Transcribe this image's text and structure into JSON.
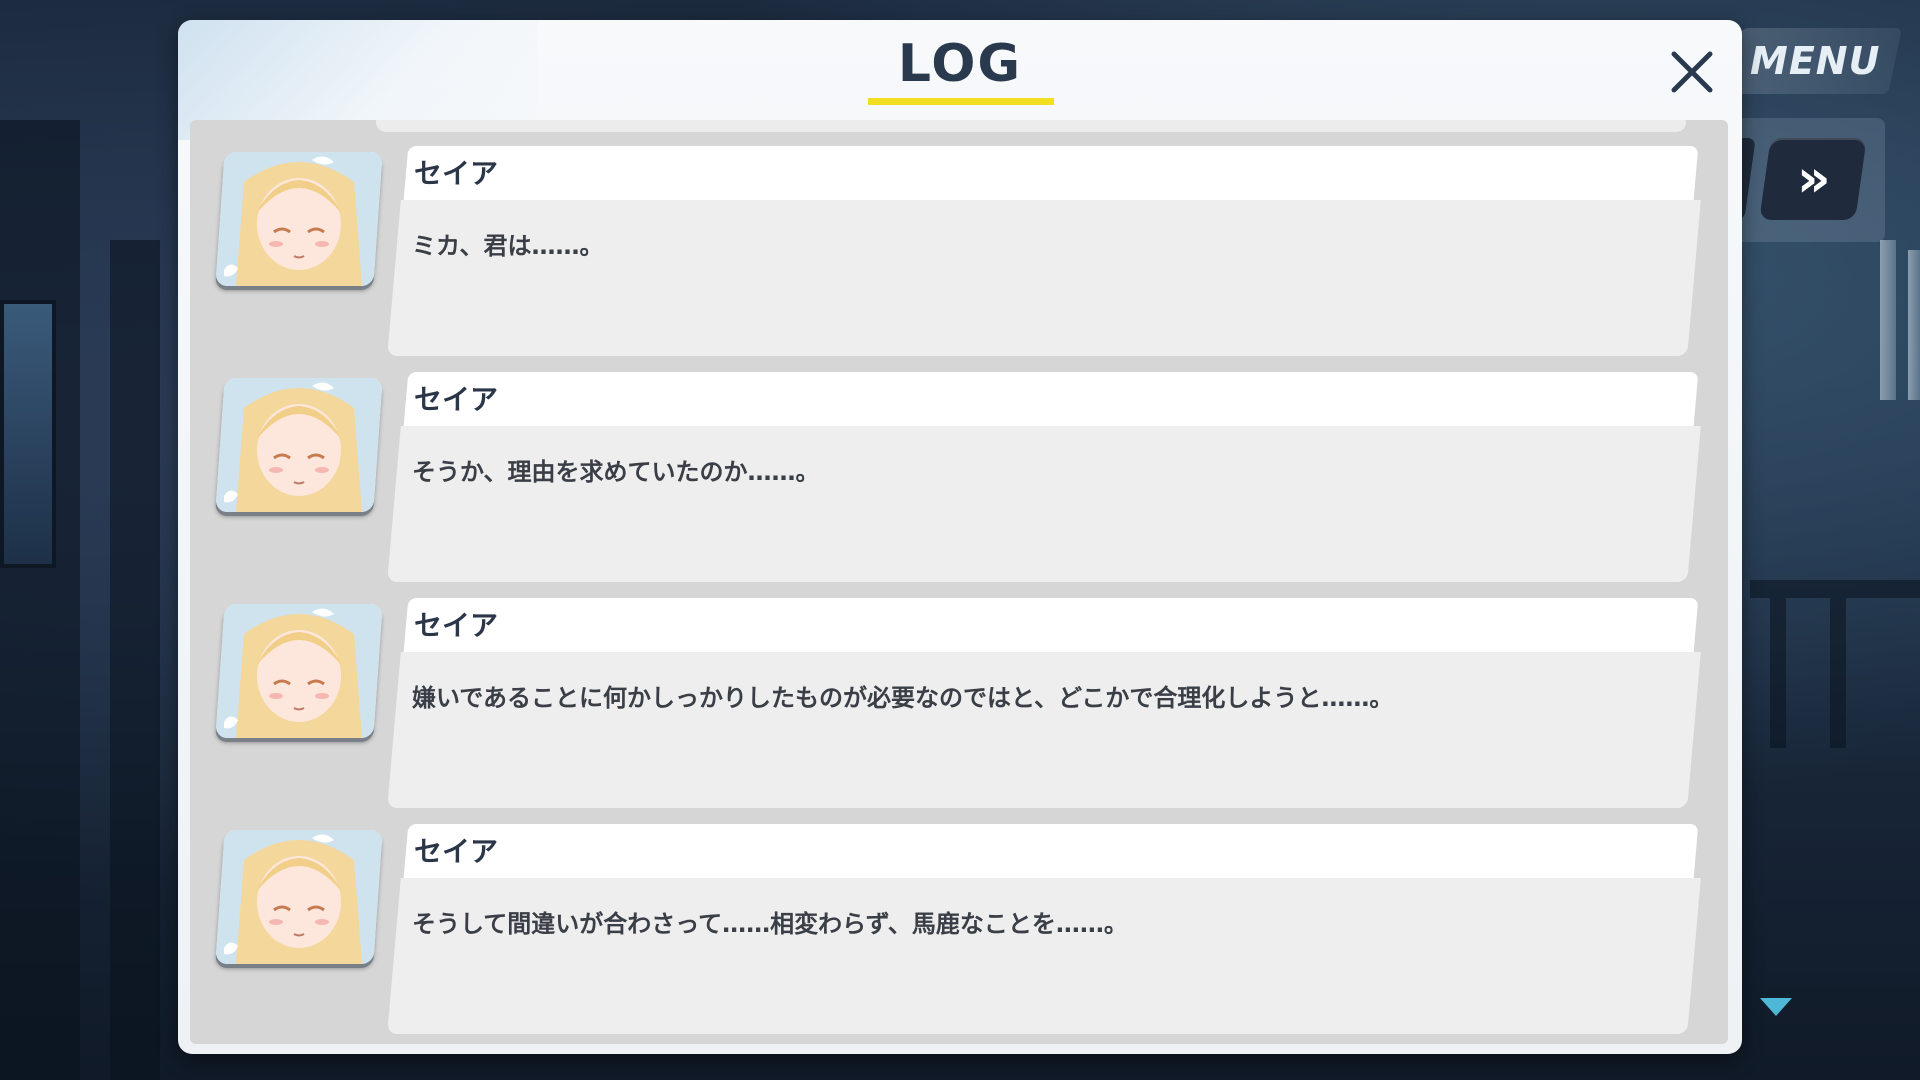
{
  "header": {
    "title": "LOG",
    "close_icon": "close-icon"
  },
  "side_controls": {
    "menu_label": "MENU",
    "skip_label": "»",
    "scroll_down_icon": "triangle-down-icon"
  },
  "colors": {
    "title_underline": "#f2df21",
    "panel_bg": "#f4f6f8",
    "list_bg": "#d5d6d5",
    "name_text": "#2b3748",
    "accent_arrow": "#4fb8d8"
  },
  "entries": [
    {
      "speaker": "セイア",
      "text": "ミカ、君は……。",
      "portrait": "seia-portrait"
    },
    {
      "speaker": "セイア",
      "text": "そうか、理由を求めていたのか……。",
      "portrait": "seia-portrait"
    },
    {
      "speaker": "セイア",
      "text": "嫌いであることに何かしっかりしたものが必要なのではと、どこかで合理化しようと……。",
      "portrait": "seia-portrait"
    },
    {
      "speaker": "セイア",
      "text": "そうして間違いが合わさって……相変わらず、馬鹿なことを……。",
      "portrait": "seia-portrait"
    }
  ]
}
